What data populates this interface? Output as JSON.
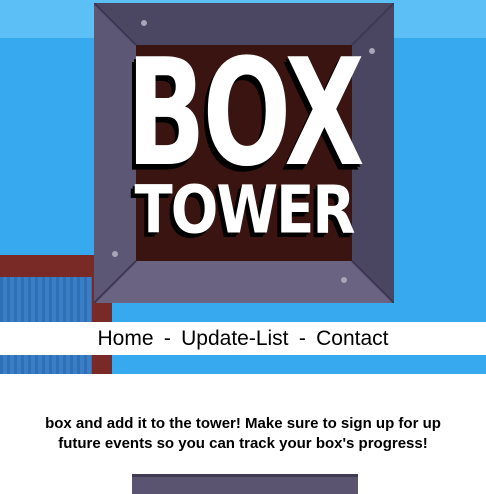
{
  "logo": {
    "word_top": "BOX",
    "word_bottom": "TOWER"
  },
  "nav": {
    "items": [
      {
        "label": "Home"
      },
      {
        "label": "Update-List"
      },
      {
        "label": "Contact"
      }
    ],
    "separator": "-"
  },
  "main": {
    "intro_line1": "box and add it to the tower! Make sure to sign up for up",
    "intro_line2": "future events so you can track your box's progress!"
  },
  "colors": {
    "sky": "#36a9ef",
    "box_frame": "#5a5470",
    "box_core": "#3a1410",
    "side_crate_border": "#7a2a26",
    "side_crate_fill": "#2f6fb6"
  }
}
